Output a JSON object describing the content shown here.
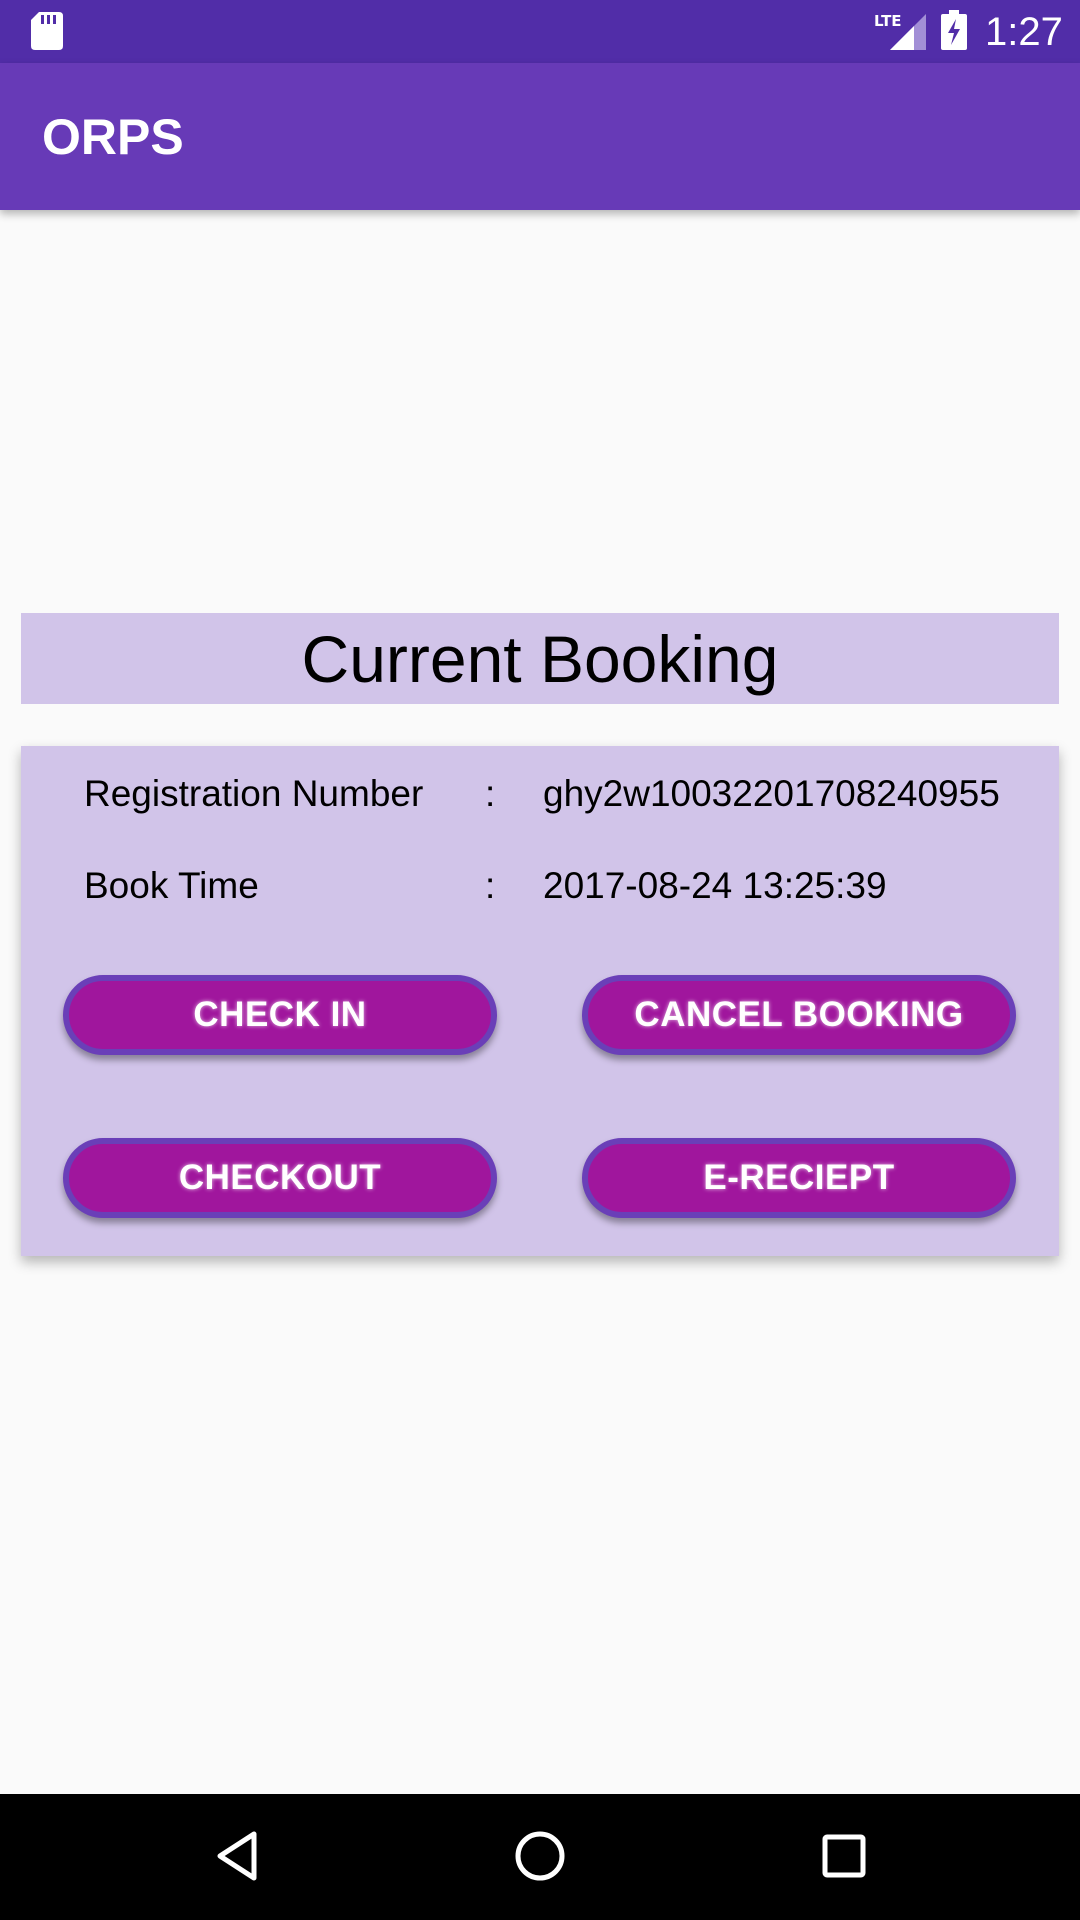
{
  "status_bar": {
    "network": "LTE",
    "time": "1:27",
    "icons": [
      "sd-card-icon",
      "lte-signal-icon",
      "battery-charging-icon"
    ]
  },
  "app_bar": {
    "title": "ORPS",
    "color": "#673ab7"
  },
  "booking": {
    "header": "Current Booking",
    "rows": [
      {
        "label": "Registration Number",
        "separator": ":",
        "value": "ghy2w10032201708240955"
      },
      {
        "label": "Book Time",
        "separator": ":",
        "value": "2017-08-24 13:25:39"
      }
    ],
    "buttons": {
      "check_in": "CHECK IN",
      "cancel_booking": "CANCEL BOOKING",
      "checkout": "CHECKOUT",
      "e_receipt": "E-RECIEPT"
    }
  },
  "colors": {
    "status_bar": "#512da8",
    "card_background": "#d1c4e9",
    "button_fill": "#a0169d",
    "button_border": "#6a3fb8"
  },
  "nav_bar": {
    "icons": [
      "back-icon",
      "home-icon",
      "recents-icon"
    ]
  }
}
